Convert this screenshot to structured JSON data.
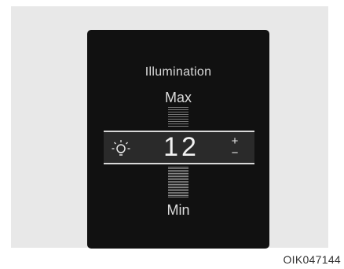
{
  "screen": {
    "title": "Illumination",
    "max_label": "Max",
    "min_label": "Min",
    "level_value": "12",
    "level_max": 20,
    "icons": {
      "bulb": "light-bulb-icon",
      "increase": "plus-icon",
      "decrease": "minus-icon"
    },
    "increase_symbol": "+",
    "decrease_symbol": "−"
  },
  "caption": "OIK047144",
  "colors": {
    "screen_background": "#111111",
    "text": "#dcdcdc",
    "highlight_bar": "#2a2a2a"
  }
}
